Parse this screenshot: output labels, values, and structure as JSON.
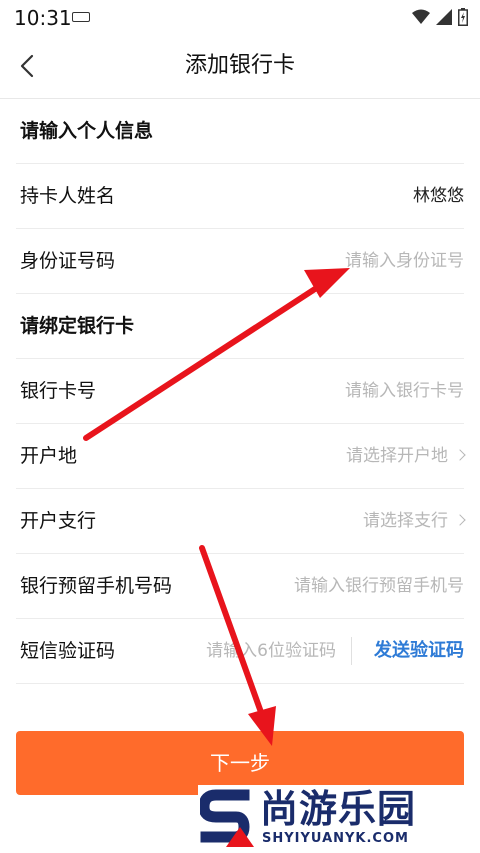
{
  "status_bar": {
    "time": "10:31"
  },
  "nav": {
    "title": "添加银行卡"
  },
  "sections": {
    "personal": "请输入个人信息",
    "bank": "请绑定银行卡"
  },
  "fields": {
    "cardholder": {
      "label": "持卡人姓名",
      "value": "林悠悠"
    },
    "id_number": {
      "label": "身份证号码",
      "placeholder": "请输入身份证号"
    },
    "card_number": {
      "label": "银行卡号",
      "placeholder": "请输入银行卡号"
    },
    "open_location": {
      "label": "开户地",
      "placeholder": "请选择开户地"
    },
    "branch": {
      "label": "开户支行",
      "placeholder": "请选择支行"
    },
    "phone": {
      "label": "银行预留手机号码",
      "placeholder": "请输入银行预留手机号"
    },
    "sms_code": {
      "label": "短信验证码",
      "placeholder": "请输入6位验证码",
      "send_label": "发送验证码"
    }
  },
  "next_button": {
    "label": "下一步"
  },
  "watermark": {
    "cn": "尚游乐园",
    "en": "SHYIYUANYK.COM"
  },
  "colors": {
    "accent": "#ff6b2b",
    "link": "#2e7bd6",
    "annotation": "#e8141c",
    "watermark": "#1a2c6b"
  }
}
